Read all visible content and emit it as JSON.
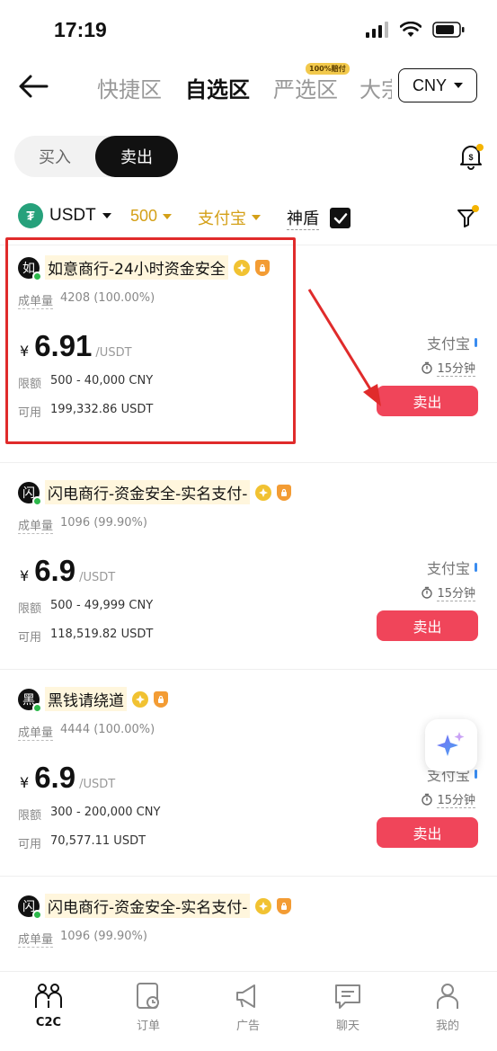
{
  "status": {
    "time": "17:19"
  },
  "nav": {
    "tabs": [
      "快捷区",
      "自选区",
      "严选区",
      "大宗"
    ],
    "active_tab": "自选区",
    "tab_badge": "100%赔付",
    "currency": "CNY"
  },
  "toggle": {
    "buy": "买入",
    "sell": "卖出",
    "active": "卖出"
  },
  "filters": {
    "coin": "USDT",
    "coin_icon": "₮",
    "amount": "500",
    "payment": "支付宝",
    "shield": "神盾",
    "shield_checked": true
  },
  "listings": [
    {
      "avatar_char": "如",
      "name": "如意商行-24小时资金安全",
      "stats_label": "成单量",
      "stats_value": "4208 (100.00%)",
      "currency_symbol": "¥",
      "price": "6.91",
      "unit": "/USDT",
      "limit_label": "限额",
      "limit_value": "500 - 40,000 CNY",
      "avail_label": "可用",
      "avail_value": "199,332.86 USDT",
      "payment": "支付宝",
      "time": "15分钟",
      "action": "卖出"
    },
    {
      "avatar_char": "闪",
      "name": "闪电商行-资金安全-实名支付-",
      "stats_label": "成单量",
      "stats_value": "1096 (99.90%)",
      "currency_symbol": "¥",
      "price": "6.9",
      "unit": "/USDT",
      "limit_label": "限额",
      "limit_value": "500 - 49,999 CNY",
      "avail_label": "可用",
      "avail_value": "118,519.82 USDT",
      "payment": "支付宝",
      "time": "15分钟",
      "action": "卖出"
    },
    {
      "avatar_char": "黑",
      "name": "黑钱请绕道",
      "stats_label": "成单量",
      "stats_value": "4444 (100.00%)",
      "currency_symbol": "¥",
      "price": "6.9",
      "unit": "/USDT",
      "limit_label": "限额",
      "limit_value": "300 - 200,000 CNY",
      "avail_label": "可用",
      "avail_value": "70,577.11 USDT",
      "payment": "支付宝",
      "time": "15分钟",
      "action": "卖出"
    },
    {
      "avatar_char": "闪",
      "name": "闪电商行-资金安全-实名支付-",
      "stats_label": "成单量",
      "stats_value": "1096 (99.90%)"
    }
  ],
  "bottom_nav": [
    "C2C",
    "订单",
    "广告",
    "聊天",
    "我的"
  ],
  "colors": {
    "sell": "#f0455a",
    "gold": "#d4a017",
    "highlight": "#e02b2b",
    "online": "#2db84b"
  }
}
